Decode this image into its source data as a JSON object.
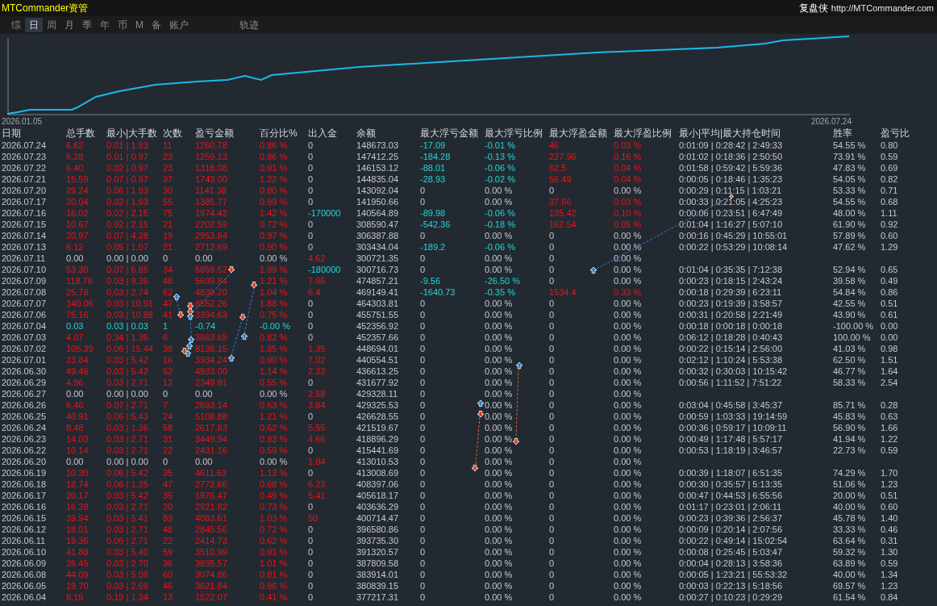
{
  "header": {
    "title": "MTCommander资管",
    "brand": "复盘侠",
    "url": "http://MTCommander.com"
  },
  "tabs": [
    {
      "label": "综",
      "selected": false
    },
    {
      "label": "日",
      "selected": true
    },
    {
      "label": "周",
      "selected": false
    },
    {
      "label": "月",
      "selected": false
    },
    {
      "label": "季",
      "selected": false
    },
    {
      "label": "年",
      "selected": false
    },
    {
      "label": "币",
      "selected": false
    },
    {
      "label": "M",
      "selected": false
    },
    {
      "label": "备",
      "selected": false
    },
    {
      "label": "账户",
      "selected": false
    }
  ],
  "track_button": {
    "label": "轨迹"
  },
  "equity_chart": {
    "start_label": "2026.01.05",
    "end_label": "2026.07.24"
  },
  "table": {
    "columns": [
      "日期",
      "总手数",
      "最小|大手数",
      "次数",
      "盈亏金额",
      "百分比%",
      "出入金",
      "余额",
      "最大浮亏金额",
      "最大浮亏比例",
      "最大浮盈金额",
      "最大浮盈比例",
      "最小|平均|最大持仓时间",
      "胜率",
      "盈亏比"
    ],
    "rows": [
      {
        "cells": [
          "2026.07.24",
          "6.62",
          "0.01 | 1.93",
          "11",
          "1260.78",
          "0.86 %",
          "0",
          "148673.03",
          "-17.09",
          "-0.01 %",
          "46",
          "0.03 %",
          "0:01:09 | 0:28:42 | 2:49:33",
          "54.55 %",
          "0.80"
        ],
        "idle": false,
        "loss": false,
        "transfer": false,
        "float_loss": true,
        "float_profit": true
      },
      {
        "cells": [
          "2026.07.23",
          "6.28",
          "0.01 | 0.97",
          "23",
          "1259.13",
          "0.86 %",
          "0",
          "147412.25",
          "-184.28",
          "-0.13 %",
          "227.96",
          "0.16 %",
          "0:01:02 | 0:18:36 | 2:50:50",
          "73.91 %",
          "0.59"
        ],
        "idle": false,
        "loss": false,
        "transfer": false,
        "float_loss": true,
        "float_profit": true
      },
      {
        "cells": [
          "2026.07.22",
          "6.40",
          "0.02 | 0.97",
          "23",
          "1318.08",
          "0.91 %",
          "0",
          "146153.12",
          "-88.01",
          "-0.06 %",
          "62.5",
          "0.04 %",
          "0:01:58 | 0:59:42 | 5:59:36",
          "47.83 %",
          "0.69"
        ],
        "idle": false,
        "loss": false,
        "transfer": false,
        "float_loss": true,
        "float_profit": true
      },
      {
        "cells": [
          "2026.07.21",
          "15.59",
          "0.07 | 0.97",
          "37",
          "1743.00",
          "1.22 %",
          "0",
          "144835.04",
          "-28.93",
          "-0.02 %",
          "56.49",
          "0.04 %",
          "0:00:05 | 0:18:46 | 1:35:23",
          "54.05 %",
          "0.82"
        ],
        "idle": false,
        "loss": false,
        "transfer": false,
        "float_loss": true,
        "float_profit": true
      },
      {
        "cells": [
          "2026.07.20",
          "29.24",
          "0.06 | 1.93",
          "30",
          "1141.38",
          "0.80 %",
          "0",
          "143092.04",
          "0",
          "0.00 %",
          "0",
          "0.00 %",
          "0:00:29 | 0:11:15 | 1:03:21",
          "53.33 %",
          "0.71"
        ],
        "idle": false,
        "loss": false,
        "transfer": false,
        "float_loss": false,
        "float_profit": false
      },
      {
        "cells": [
          "2026.07.17",
          "20.04",
          "0.02 | 1.93",
          "55",
          "1385.77",
          "0.99 %",
          "0",
          "141950.66",
          "0",
          "0.00 %",
          "37.66",
          "0.03 %",
          "0:00:33 | 0:21:05 | 4:25:23",
          "54.55 %",
          "0.68"
        ],
        "idle": false,
        "loss": false,
        "transfer": false,
        "float_loss": false,
        "float_profit": true
      },
      {
        "cells": [
          "2026.07.16",
          "16.02",
          "0.02 | 2.15",
          "75",
          "1974.42",
          "1.42 %",
          "-170000",
          "140564.89",
          "-89.98",
          "-0.06 %",
          "135.42",
          "0.10 %",
          "0:00:06 | 0:23:51 | 6:47:49",
          "48.00 %",
          "1.11"
        ],
        "idle": false,
        "loss": false,
        "transfer": true,
        "withdrawal": true,
        "float_loss": true,
        "float_profit": true
      },
      {
        "cells": [
          "2026.07.15",
          "10.67",
          "0.02 | 2.15",
          "21",
          "2202.59",
          "0.72 %",
          "0",
          "308590.47",
          "-542.36",
          "-0.18 %",
          "162.54",
          "0.05 %",
          "0:01:04 | 1:16:27 | 5:07:10",
          "61.90 %",
          "0.92"
        ],
        "idle": false,
        "loss": false,
        "transfer": false,
        "float_loss": true,
        "float_profit": true
      },
      {
        "cells": [
          "2026.07.14",
          "20.97",
          "0.07 | 4.28",
          "19",
          "2953.84",
          "0.97 %",
          "0",
          "306387.88",
          "0",
          "0.00 %",
          "0",
          "0.00 %",
          "0:00:16 | 0:45:29 | 10:55:01",
          "57.89 %",
          "0.60"
        ],
        "idle": false,
        "loss": false,
        "transfer": false,
        "float_loss": false,
        "float_profit": false
      },
      {
        "cells": [
          "2026.07.13",
          "6.12",
          "0.05 | 1.07",
          "21",
          "2712.69",
          "0.90 %",
          "0",
          "303434.04",
          "-189.2",
          "-0.06 %",
          "0",
          "0.00 %",
          "0:00:22 | 0:53:29 | 10:08:14",
          "47.62 %",
          "1.29"
        ],
        "idle": false,
        "loss": false,
        "transfer": false,
        "float_loss": true,
        "float_profit": false
      },
      {
        "cells": [
          "2026.07.11",
          "0.00",
          "0.00 | 0.00",
          "0",
          "0.00",
          "0.00 %",
          "4.62",
          "300721.35",
          "0",
          "0.00 %",
          "0",
          "0.00 %"
        ],
        "idle": true,
        "transfer": true,
        "withdrawal": false,
        "float_loss": false,
        "float_profit": false
      },
      {
        "cells": [
          "2026.07.10",
          "53.30",
          "0.07 | 6.85",
          "34",
          "5859.52",
          "1.99 %",
          "-180000",
          "300716.73",
          "0",
          "0.00 %",
          "0",
          "0.00 %",
          "0:01:04 | 0:35:35 | 7:12:38",
          "52.94 %",
          "0.65"
        ],
        "idle": false,
        "loss": false,
        "transfer": true,
        "withdrawal": true,
        "float_loss": false,
        "float_profit": false
      },
      {
        "cells": [
          "2026.07.09",
          "118.76",
          "0.03 | 9.36",
          "48",
          "5699.84",
          "1.21 %",
          "7.96",
          "474857.21",
          "-9.56",
          "-26.50 %",
          "0",
          "0.00 %",
          "0:00:23 | 0:18:15 | 2:43:24",
          "39.58 %",
          "0.49"
        ],
        "idle": false,
        "loss": false,
        "transfer": true,
        "withdrawal": false,
        "float_loss": true,
        "float_profit": false
      },
      {
        "cells": [
          "2026.07.08",
          "25.78",
          "0.03 | 2.74",
          "62",
          "4839.20",
          "1.04 %",
          "6.4",
          "469149.41",
          "-1640.73",
          "-0.35 %",
          "1534.4",
          "0.33 %",
          "0:00:18 | 0:29:39 | 6:23:11",
          "54.84 %",
          "0.86"
        ],
        "idle": false,
        "loss": false,
        "transfer": true,
        "withdrawal": false,
        "float_loss": true,
        "float_profit": true
      },
      {
        "cells": [
          "2026.07.07",
          "140.06",
          "0.03 | 10.91",
          "47",
          "8552.26",
          "1.88 %",
          "0",
          "464303.81",
          "0",
          "0.00 %",
          "0",
          "0.00 %",
          "0:00:23 | 0:19:39 | 3:58:57",
          "42.55 %",
          "0.51"
        ],
        "idle": false,
        "loss": false,
        "transfer": false,
        "float_loss": false,
        "float_profit": false
      },
      {
        "cells": [
          "2026.07.06",
          "75.16",
          "0.03 | 10.88",
          "41",
          "3394.63",
          "0.75 %",
          "0",
          "455751.55",
          "0",
          "0.00 %",
          "0",
          "0.00 %",
          "0:00:31 | 0:20:58 | 2:21:49",
          "43.90 %",
          "0.61"
        ],
        "idle": false,
        "loss": false,
        "transfer": false,
        "float_loss": false,
        "float_profit": false
      },
      {
        "cells": [
          "2026.07.04",
          "0.03",
          "0.03 | 0.03",
          "1",
          "-0.74",
          "-0.00 %",
          "0",
          "452356.92",
          "0",
          "0.00 %",
          "0",
          "0.00 %",
          "0:00:18 | 0:00:18 | 0:00:18",
          "-100.00 %",
          "0.00"
        ],
        "idle": false,
        "loss": true,
        "transfer": false,
        "float_loss": false,
        "float_profit": false
      },
      {
        "cells": [
          "2026.07.03",
          "4.07",
          "0.34 | 1.36",
          "6",
          "3663.65",
          "0.82 %",
          "0",
          "452357.66",
          "0",
          "0.00 %",
          "0",
          "0.00 %",
          "0:06:12 | 0:18:28 | 0:40:43",
          "100.00 %",
          "0.00"
        ],
        "idle": false,
        "loss": false,
        "transfer": false,
        "float_loss": false,
        "float_profit": false
      },
      {
        "cells": [
          "2026.07.02",
          "105.39",
          "0.06 | 15.44",
          "39",
          "8138.15",
          "1.85 %",
          "1.35",
          "448694.01",
          "0",
          "0.00 %",
          "0",
          "0.00 %",
          "0:00:22 | 0:15:14 | 2:56:00",
          "41.03 %",
          "0.98"
        ],
        "idle": false,
        "loss": false,
        "transfer": true,
        "withdrawal": false,
        "float_loss": false,
        "float_profit": false
      },
      {
        "cells": [
          "2026.07.01",
          "23.84",
          "0.03 | 5.42",
          "16",
          "3934.24",
          "0.90 %",
          "7.02",
          "440554.51",
          "0",
          "0.00 %",
          "0",
          "0.00 %",
          "0:02:12 | 1:10:24 | 5:53:38",
          "62.50 %",
          "1.51"
        ],
        "idle": false,
        "loss": false,
        "transfer": true,
        "withdrawal": false,
        "float_loss": false,
        "float_profit": false
      },
      {
        "cells": [
          "2026.06.30",
          "49.46",
          "0.03 | 5.42",
          "62",
          "4933.00",
          "1.14 %",
          "2.33",
          "436613.25",
          "0",
          "0.00 %",
          "0",
          "0.00 %",
          "0:00:32 | 0:30:03 | 10:15:42",
          "46.77 %",
          "1.64"
        ],
        "idle": false,
        "loss": false,
        "transfer": true,
        "withdrawal": false,
        "float_loss": false,
        "float_profit": false
      },
      {
        "cells": [
          "2026.06.29",
          "4.96",
          "0.03 | 2.71",
          "12",
          "2349.81",
          "0.55 %",
          "0",
          "431677.92",
          "0",
          "0.00 %",
          "0",
          "0.00 %",
          "0:00:56 | 1:11:52 | 7:51:22",
          "58.33 %",
          "2.54"
        ],
        "idle": false,
        "loss": false,
        "transfer": false,
        "float_loss": false,
        "float_profit": false
      },
      {
        "cells": [
          "2026.06.27",
          "0.00",
          "0.00 | 0.00",
          "0",
          "0.00",
          "0.00 %",
          "2.58",
          "429328.11",
          "0",
          "0.00 %",
          "0",
          "0.00 %"
        ],
        "idle": true,
        "transfer": true,
        "withdrawal": false,
        "float_loss": false,
        "float_profit": false
      },
      {
        "cells": [
          "2026.06.26",
          "6.46",
          "0.07 | 2.71",
          "7",
          "2693.14",
          "0.63 %",
          "3.84",
          "429325.53",
          "0",
          "0.00 %",
          "0",
          "0.00 %",
          "0:03:04 | 0:45:58 | 3:45:37",
          "85.71 %",
          "0.28"
        ],
        "idle": false,
        "loss": false,
        "transfer": true,
        "withdrawal": false,
        "float_loss": false,
        "float_profit": false
      },
      {
        "cells": [
          "2026.06.25",
          "40.91",
          "0.06 | 5.43",
          "24",
          "5108.88",
          "1.21 %",
          "0",
          "426628.55",
          "0",
          "0.00 %",
          "0",
          "0.00 %",
          "0:00:59 | 1:03:33 | 19:14:59",
          "45.83 %",
          "0.63"
        ],
        "idle": false,
        "loss": false,
        "transfer": false,
        "float_loss": false,
        "float_profit": false
      },
      {
        "cells": [
          "2026.06.24",
          "8.48",
          "0.03 | 1.36",
          "58",
          "2617.83",
          "0.62 %",
          "5.55",
          "421519.67",
          "0",
          "0.00 %",
          "0",
          "0.00 %",
          "0:00:36 | 0:59:17 | 10:09:11",
          "56.90 %",
          "1.66"
        ],
        "idle": false,
        "loss": false,
        "transfer": true,
        "withdrawal": false,
        "float_loss": false,
        "float_profit": false
      },
      {
        "cells": [
          "2026.06.23",
          "14.03",
          "0.03 | 2.71",
          "31",
          "3449.94",
          "0.83 %",
          "4.66",
          "418896.29",
          "0",
          "0.00 %",
          "0",
          "0.00 %",
          "0:00:49 | 1:17:48 | 5:57:17",
          "41.94 %",
          "1.22"
        ],
        "idle": false,
        "loss": false,
        "transfer": true,
        "withdrawal": false,
        "float_loss": false,
        "float_profit": false
      },
      {
        "cells": [
          "2026.06.22",
          "10.14",
          "0.03 | 2.71",
          "22",
          "2431.16",
          "0.59 %",
          "0",
          "415441.69",
          "0",
          "0.00 %",
          "0",
          "0.00 %",
          "0:00:53 | 1:18:19 | 3:46:57",
          "22.73 %",
          "0.59"
        ],
        "idle": false,
        "loss": false,
        "transfer": false,
        "float_loss": false,
        "float_profit": false
      },
      {
        "cells": [
          "2026.06.20",
          "0.00",
          "0.00 | 0.00",
          "0",
          "0.00",
          "0.00 %",
          "1.84",
          "413010.53",
          "0",
          "0.00 %",
          "0",
          "0.00 %"
        ],
        "idle": true,
        "transfer": true,
        "withdrawal": false,
        "float_loss": false,
        "float_profit": false
      },
      {
        "cells": [
          "2026.06.19",
          "10.30",
          "0.06 | 5.42",
          "35",
          "4611.63",
          "1.13 %",
          "0",
          "413008.69",
          "0",
          "0.00 %",
          "0",
          "0.00 %",
          "0:00:39 | 1:18:07 | 6:51:35",
          "74.29 %",
          "1.70"
        ],
        "idle": false,
        "loss": false,
        "transfer": false,
        "float_loss": false,
        "float_profit": false
      },
      {
        "cells": [
          "2026.06.18",
          "18.74",
          "0.06 | 1.35",
          "47",
          "2772.66",
          "0.68 %",
          "6.23",
          "408397.06",
          "0",
          "0.00 %",
          "0",
          "0.00 %",
          "0:00:30 | 0:35:57 | 5:13:35",
          "51.06 %",
          "1.23"
        ],
        "idle": false,
        "loss": false,
        "transfer": true,
        "withdrawal": false,
        "float_loss": false,
        "float_profit": false
      },
      {
        "cells": [
          "2026.06.17",
          "20.17",
          "0.03 | 5.42",
          "35",
          "1976.47",
          "0.49 %",
          "5.41",
          "405618.17",
          "0",
          "0.00 %",
          "0",
          "0.00 %",
          "0:00:47 | 0:44:53 | 6:55:56",
          "20.00 %",
          "0.51"
        ],
        "idle": false,
        "loss": false,
        "transfer": true,
        "withdrawal": false,
        "float_loss": false,
        "float_profit": false
      },
      {
        "cells": [
          "2026.06.16",
          "16.28",
          "0.03 | 2.71",
          "20",
          "2921.82",
          "0.73 %",
          "0",
          "403636.29",
          "0",
          "0.00 %",
          "0",
          "0.00 %",
          "0:01:17 | 0:23:01 | 2:06:11",
          "40.00 %",
          "0.60"
        ],
        "idle": false,
        "loss": false,
        "transfer": false,
        "float_loss": false,
        "float_profit": false
      },
      {
        "cells": [
          "2026.06.15",
          "39.94",
          "0.03 | 5.41",
          "83",
          "4083.61",
          "1.03 %",
          "50",
          "400714.47",
          "0",
          "0.00 %",
          "0",
          "0.00 %",
          "0:00:23 | 0:39:36 | 2:56:37",
          "45.78 %",
          "1.40"
        ],
        "idle": false,
        "loss": false,
        "transfer": true,
        "withdrawal": false,
        "float_loss": false,
        "float_profit": false
      },
      {
        "cells": [
          "2026.06.12",
          "18.01",
          "0.03 | 2.71",
          "48",
          "2845.56",
          "0.72 %",
          "0",
          "396580.86",
          "0",
          "0.00 %",
          "0",
          "0.00 %",
          "0:00:09 | 0:20:14 | 2:07:56",
          "33.33 %",
          "0.46"
        ],
        "idle": false,
        "loss": false,
        "transfer": false,
        "float_loss": false,
        "float_profit": false
      },
      {
        "cells": [
          "2026.06.11",
          "19.36",
          "0.06 | 2.71",
          "22",
          "2414.73",
          "0.62 %",
          "0",
          "393735.30",
          "0",
          "0.00 %",
          "0",
          "0.00 %",
          "0:00:22 | 0:49:14 | 15:02:54",
          "63.64 %",
          "0.31"
        ],
        "idle": false,
        "loss": false,
        "transfer": false,
        "float_loss": false,
        "float_profit": false
      },
      {
        "cells": [
          "2026.06.10",
          "41.88",
          "0.03 | 5.40",
          "59",
          "3510.99",
          "0.91 %",
          "0",
          "391320.57",
          "0",
          "0.00 %",
          "0",
          "0.00 %",
          "0:00:08 | 0:25:45 | 5:03:47",
          "59.32 %",
          "1.30"
        ],
        "idle": false,
        "loss": false,
        "transfer": false,
        "float_loss": false,
        "float_profit": false
      },
      {
        "cells": [
          "2026.06.09",
          "26.45",
          "0.03 | 2.70",
          "36",
          "3895.57",
          "1.01 %",
          "0",
          "387809.58",
          "0",
          "0.00 %",
          "0",
          "0.00 %",
          "0:00:04 | 0:28:13 | 3:58:36",
          "63.89 %",
          "0.59"
        ],
        "idle": false,
        "loss": false,
        "transfer": false,
        "float_loss": false,
        "float_profit": false
      },
      {
        "cells": [
          "2026.06.08",
          "44.09",
          "0.03 | 5.09",
          "60",
          "3074.86",
          "0.81 %",
          "0",
          "383914.01",
          "0",
          "0.00 %",
          "0",
          "0.00 %",
          "0:00:05 | 1:23:21 | 55:53:32",
          "40.00 %",
          "1.34"
        ],
        "idle": false,
        "loss": false,
        "transfer": false,
        "float_loss": false,
        "float_profit": false
      },
      {
        "cells": [
          "2026.06.05",
          "19.70",
          "0.03 | 2.69",
          "46",
          "3621.84",
          "0.96 %",
          "0",
          "380839.15",
          "0",
          "0.00 %",
          "0",
          "0.00 %",
          "0:00:03 | 0:22:13 | 5:18:56",
          "69.57 %",
          "1.23"
        ],
        "idle": false,
        "loss": false,
        "transfer": false,
        "float_loss": false,
        "float_profit": false
      },
      {
        "cells": [
          "2026.06.04",
          "8.15",
          "0.19 | 1.34",
          "13",
          "1522.07",
          "0.41 %",
          "0",
          "377217.31",
          "0",
          "0.00 %",
          "0",
          "0.00 %",
          "0:00:27 | 0:10:23 | 0:29:29",
          "61.54 %",
          "0.84"
        ],
        "idle": false,
        "loss": false,
        "transfer": false,
        "float_loss": false,
        "float_profit": false
      }
    ]
  }
}
